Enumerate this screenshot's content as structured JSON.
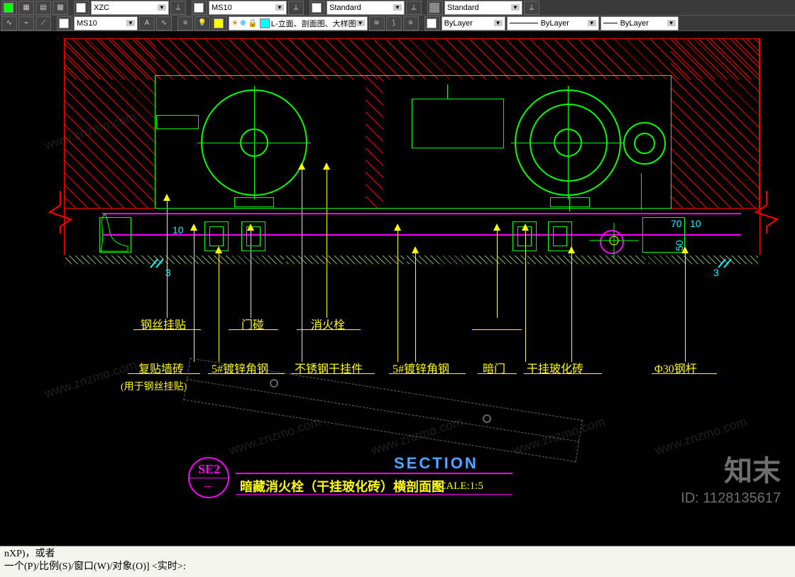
{
  "toolbars": {
    "row1": {
      "style1": "XZC",
      "style2": "MS10",
      "style3": "Standard",
      "style4": "Standard"
    },
    "row2": {
      "textstyle": "MS10",
      "layer": "L-立面、剖面图、大样图",
      "linetype1": "ByLayer",
      "linetype2": "ByLayer",
      "linetype3": "ByLayer"
    }
  },
  "dims": {
    "d10_left": "10",
    "d3_left": "3",
    "d70": "70",
    "d10_right": "10",
    "d50": "50",
    "d3_right": "3"
  },
  "labels": {
    "gsgt": "钢丝挂贴",
    "mp": "门碰",
    "xhs": "消火栓",
    "fbqz": "复贴墙砖",
    "fbqz_note": "(用于钢丝挂贴)",
    "dxjg_5_1": "5#镀锌角钢",
    "bxggjj": "不锈钢干挂件",
    "dxjg_5_2": "5#镀锌角钢",
    "anmen": "暗门",
    "ggbhz": "干挂玻化砖",
    "d30gg": "Φ30钢杆"
  },
  "title": {
    "tag_top": "SE2",
    "tag_bottom": "--",
    "name": "暗藏消火栓（干挂玻化砖）横剖面图",
    "section_word": "SECTION",
    "scale": "SCALE:1:5"
  },
  "watermark": {
    "small": "www.znzmo.com",
    "big": "知末",
    "id": "ID: 1128135617"
  },
  "command": {
    "line1": "nXP)，或者",
    "line2": "一个(P)/比例(S)/窗口(W)/对象(O)] <实时>:"
  }
}
